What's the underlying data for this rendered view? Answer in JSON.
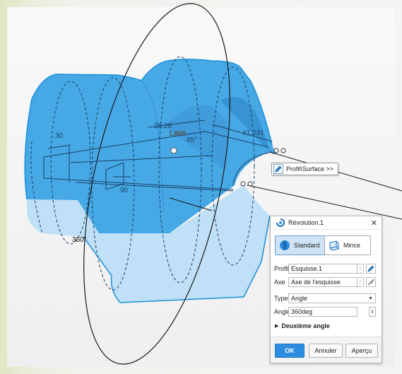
{
  "viewport": {
    "dimensions": {
      "top_left": "30",
      "top_center": "28,28",
      "angle_small": "45°",
      "right": "41,231",
      "bottom": "90",
      "revolution_angle": "360°"
    },
    "lim_label": "LIM8",
    "colors": {
      "solid": "#46a9e6",
      "solid_light": "#b9def6",
      "edge": "#1a8fd8",
      "sketch": "#1b3f66"
    }
  },
  "tooltip": {
    "label": "Profil\\Surface >>"
  },
  "dialog": {
    "title": "Révolution.1",
    "modes": [
      "Standard",
      "Mince"
    ],
    "fields": {
      "profil": {
        "label": "Profil",
        "value": "Esquisse.1"
      },
      "axe": {
        "label": "Axe",
        "value": "Axe de l'esquisse"
      },
      "type": {
        "label": "Type",
        "value": "Angle"
      },
      "angle": {
        "label": "Angle",
        "value": "360deg"
      }
    },
    "second_angle": "Deuxième angle",
    "buttons": {
      "ok": "OK",
      "cancel": "Annuler",
      "preview": "Aperçu"
    }
  }
}
